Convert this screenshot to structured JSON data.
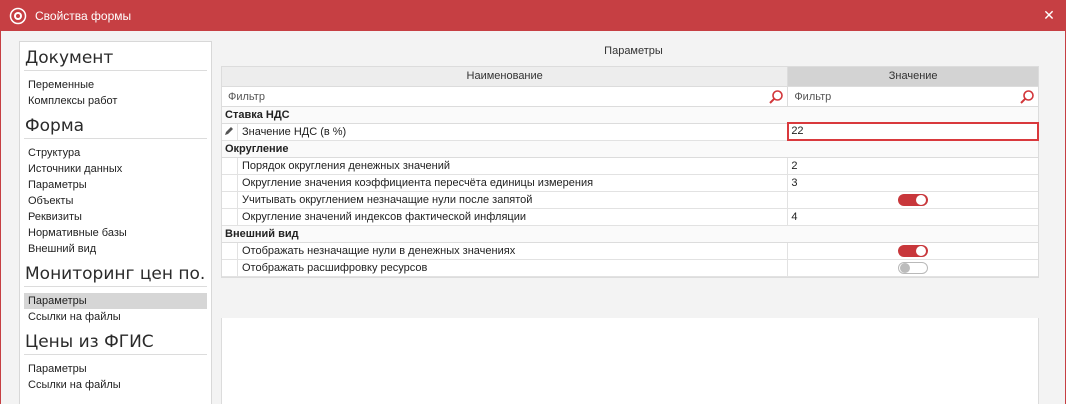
{
  "window": {
    "title": "Свойства формы",
    "close_glyph": "✕",
    "icon": "app-logo-icon"
  },
  "colors": {
    "accent": "#c63f43",
    "toggle_on": "#c8373b"
  },
  "nav": {
    "sections": [
      {
        "header": "Документ",
        "items": [
          "Переменные",
          "Комплексы работ"
        ]
      },
      {
        "header": "Форма",
        "items": [
          "Структура",
          "Источники данных",
          "Параметры",
          "Объекты",
          "Реквизиты",
          "Нормативные базы",
          "Внешний вид"
        ]
      },
      {
        "header": "Мониторинг цен по...",
        "items": [
          "Параметры",
          "Ссылки на файлы"
        ],
        "active_index": 0
      },
      {
        "header": "Цены из ФГИС",
        "items": [
          "Параметры",
          "Ссылки на файлы"
        ]
      }
    ]
  },
  "panel": {
    "title": "Параметры",
    "columns": {
      "name": "Наименование",
      "value": "Значение"
    },
    "filter": {
      "name_placeholder": "Фильтр",
      "value_placeholder": "Фильтр"
    },
    "groups": [
      {
        "name": "Ставка НДС",
        "rows": [
          {
            "name": "Значение НДС (в %)",
            "value": "22",
            "editing": true,
            "gutter_icon": "pencil-icon"
          }
        ]
      },
      {
        "name": "Округление",
        "rows": [
          {
            "name": "Порядок округления денежных значений",
            "value": "2"
          },
          {
            "name": "Округление значения коэффициента пересчёта единицы измерения",
            "value": "3"
          },
          {
            "name": "Учитывать округлением незначащие нули после запятой",
            "toggle": true
          },
          {
            "name": "Округление значений индексов фактической инфляции",
            "value": "4"
          }
        ]
      },
      {
        "name": "Внешний вид",
        "rows": [
          {
            "name": "Отображать незначащие нули в денежных значениях",
            "toggle": true
          },
          {
            "name": "Отображать расшифровку ресурсов",
            "toggle": false
          }
        ]
      }
    ]
  }
}
